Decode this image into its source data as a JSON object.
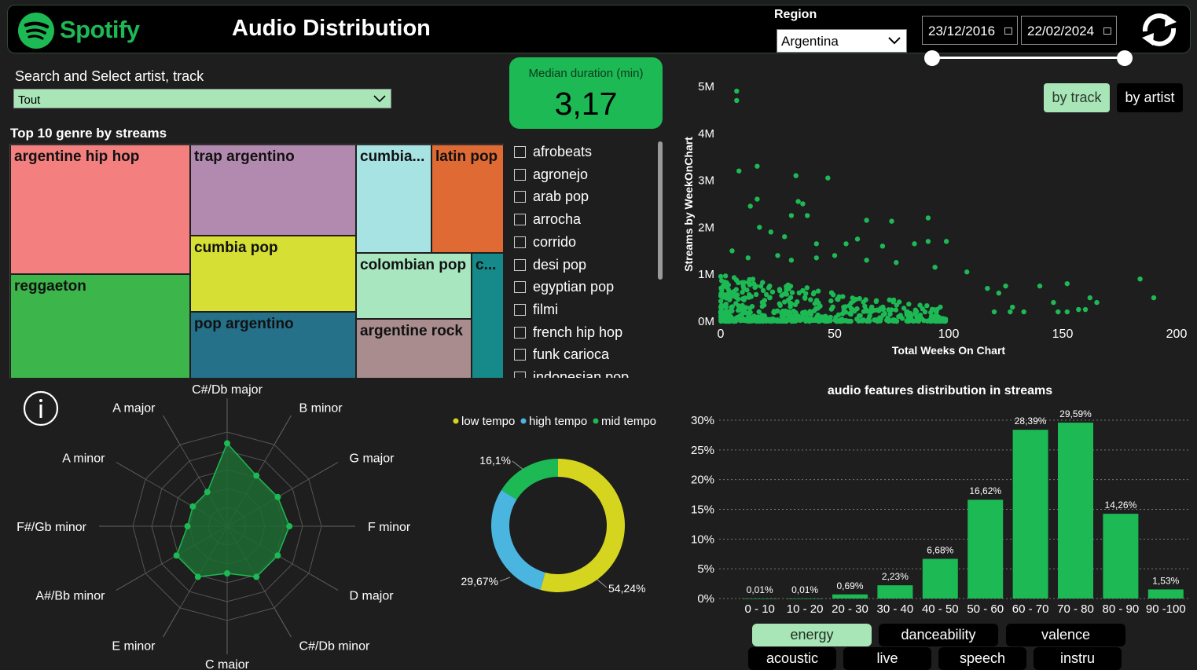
{
  "header": {
    "brand": "Spotify",
    "title": "Audio Distribution",
    "region_label": "Region",
    "region_value": "Argentina",
    "start_date": "23/12/2016",
    "end_date": "22/02/2024",
    "date_range": [
      0,
      1
    ]
  },
  "search": {
    "label": "Search and Select artist, track",
    "value": "Tout"
  },
  "median_card": {
    "label": "Median duration (min)",
    "value": "3,17"
  },
  "treemap": {
    "title": "Top 10 genre by streams",
    "cells": [
      {
        "label": "argentine hip hop",
        "color": "#f47f7f"
      },
      {
        "label": "reggaeton",
        "color": "#3cb54a"
      },
      {
        "label": "trap argentino",
        "color": "#b38aaf"
      },
      {
        "label": "cumbia pop",
        "color": "#d6e034"
      },
      {
        "label": "pop argentino",
        "color": "#25718a"
      },
      {
        "label": "cumbia...",
        "color": "#a7e3e3"
      },
      {
        "label": "latin pop",
        "color": "#e06a34"
      },
      {
        "label": "colombian pop",
        "color": "#a8e6c0"
      },
      {
        "label": "c...",
        "color": "#168a8a"
      },
      {
        "label": "argentine rock",
        "color": "#a88c8e"
      }
    ]
  },
  "genre_list": [
    "afrobeats",
    "agronejo",
    "arab pop",
    "arrocha",
    "corrido",
    "desi pop",
    "egyptian pop",
    "filmi",
    "french hip hop",
    "funk carioca",
    "indonesian pop"
  ],
  "scatter_toggle": {
    "by_track": "by track",
    "by_artist": "by artist",
    "selected": "by track"
  },
  "feature_buttons": {
    "energy": "energy",
    "danceability": "danceability",
    "valence": "valence",
    "acoustic": "acoustic",
    "live": "live",
    "speech": "speech",
    "instru": "instru",
    "selected": "energy"
  },
  "colors": {
    "accent": "#1db954",
    "background": "#1e1e1e",
    "selected_button": "#a8e6b8"
  },
  "chart_data": [
    {
      "type": "radar",
      "categories": [
        "C#/Db major",
        "B minor",
        "G major",
        "F minor",
        "D major",
        "C#/Db minor",
        "C major",
        "E minor",
        "A#/Bb minor",
        "F#/Gb minor",
        "A minor",
        "A major"
      ],
      "values": [
        0.88,
        0.62,
        0.62,
        0.66,
        0.62,
        0.62,
        0.5,
        0.62,
        0.62,
        0.42,
        0.42,
        0.42
      ],
      "range": [
        0,
        1
      ]
    },
    {
      "type": "pie",
      "labels": [
        "low tempo",
        "high tempo",
        "mid tempo"
      ],
      "values": [
        54.24,
        29.67,
        16.09
      ],
      "value_labels": [
        "54,24%",
        "29,67%",
        "16,1%"
      ],
      "colors": [
        "#d5d520",
        "#4ab6e0",
        "#1db954"
      ]
    },
    {
      "type": "scatter",
      "xlabel": "Total Weeks On Chart",
      "ylabel": "Streams by WeekOnChart",
      "xlim": [
        0,
        200
      ],
      "ylim": [
        0,
        5000000
      ],
      "xticks": [
        "0",
        "50",
        "100",
        "150",
        "200"
      ],
      "yticks": [
        "0M",
        "1M",
        "2M",
        "3M",
        "4M",
        "5M"
      ],
      "points": [
        [
          7,
          4900000
        ],
        [
          7,
          4700000
        ],
        [
          8,
          3200000
        ],
        [
          16,
          3300000
        ],
        [
          33,
          3100000
        ],
        [
          47,
          3050000
        ],
        [
          13,
          2450000
        ],
        [
          16,
          2600000
        ],
        [
          34,
          2550000
        ],
        [
          36,
          2500000
        ],
        [
          31,
          2250000
        ],
        [
          38,
          2250000
        ],
        [
          64,
          2150000
        ],
        [
          75,
          2130000
        ],
        [
          91,
          2200000
        ],
        [
          17,
          2000000
        ],
        [
          22,
          1900000
        ],
        [
          28,
          1800000
        ],
        [
          42,
          1650000
        ],
        [
          55,
          1650000
        ],
        [
          60,
          1750000
        ],
        [
          71,
          1600000
        ],
        [
          85,
          1650000
        ],
        [
          91,
          1700000
        ],
        [
          99,
          1700000
        ],
        [
          5,
          1500000
        ],
        [
          12,
          1350000
        ],
        [
          25,
          1400000
        ],
        [
          31,
          1300000
        ],
        [
          42,
          1350000
        ],
        [
          50,
          1400000
        ],
        [
          64,
          1300000
        ],
        [
          77,
          1250000
        ],
        [
          94,
          1150000
        ],
        [
          108,
          1050000
        ],
        [
          117,
          700000
        ],
        [
          122,
          600000
        ],
        [
          125,
          750000
        ],
        [
          120,
          200000
        ],
        [
          127,
          200000
        ],
        [
          133,
          200000
        ],
        [
          128,
          300000
        ],
        [
          140,
          750000
        ],
        [
          146,
          400000
        ],
        [
          148,
          200000
        ],
        [
          152,
          200000
        ],
        [
          157,
          250000
        ],
        [
          160,
          250000
        ],
        [
          162,
          500000
        ],
        [
          165,
          400000
        ],
        [
          152,
          800000
        ],
        [
          190,
          500000
        ],
        [
          184,
          900000
        ]
      ],
      "dense_cluster": {
        "x": [
          0,
          100
        ],
        "y": [
          0,
          1000000
        ]
      }
    },
    {
      "type": "bar",
      "title": "audio features distribution in streams",
      "categories": [
        "0 - 10",
        "10 - 20",
        "20 - 30",
        "30 - 40",
        "40 - 50",
        "50 - 60",
        "60 - 70",
        "70 - 80",
        "80 - 90",
        "90 -100"
      ],
      "values": [
        0.01,
        0.01,
        0.69,
        2.23,
        6.68,
        16.62,
        28.39,
        29.59,
        14.26,
        1.53
      ],
      "value_labels": [
        "0,01%",
        "0,01%",
        "0,69%",
        "2,23%",
        "6,68%",
        "16,62%",
        "28,39%",
        "29,59%",
        "14,26%",
        "1,53%"
      ],
      "ylim": [
        0,
        30
      ],
      "yticks": [
        "0%",
        "5%",
        "10%",
        "15%",
        "20%",
        "25%",
        "30%"
      ],
      "color": "#1db954"
    }
  ]
}
